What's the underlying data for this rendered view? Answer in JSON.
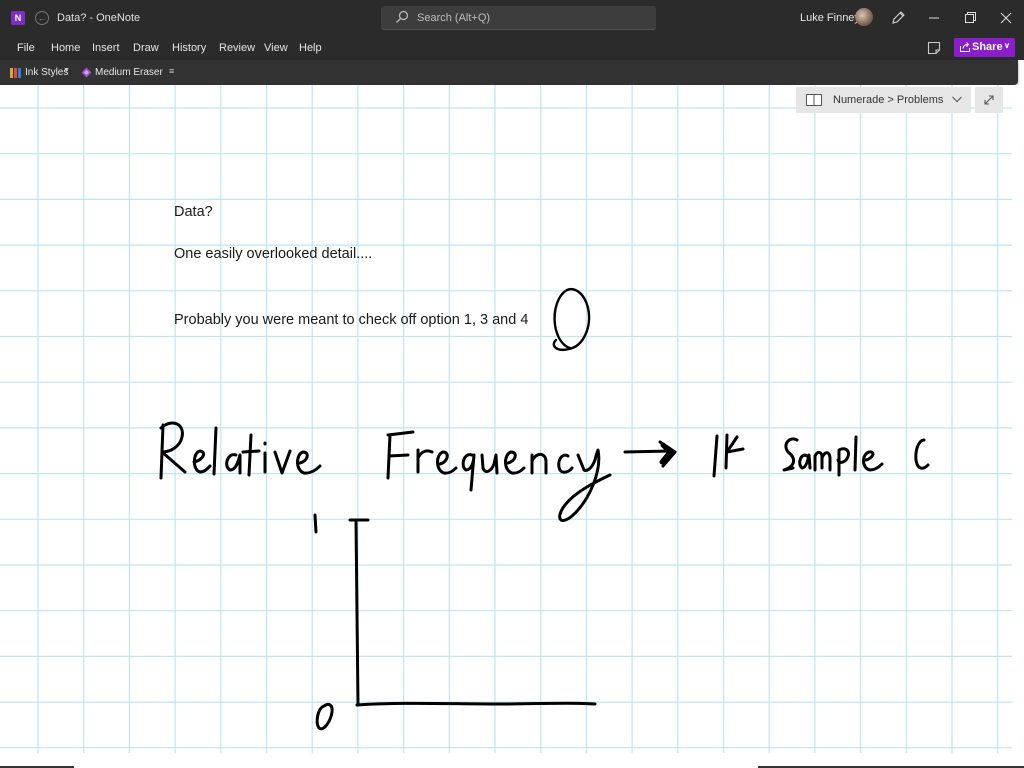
{
  "titlebar": {
    "app_icon_letter": "N",
    "window_title": "Data?  -  OneNote",
    "search_placeholder": "Search (Alt+Q)",
    "user_name": "Luke Finney"
  },
  "menu": {
    "items": [
      "File",
      "Home",
      "Insert",
      "Draw",
      "History",
      "Review",
      "View",
      "Help"
    ],
    "share_label": "Share"
  },
  "toolbar": {
    "ink_styles_label": "Ink Styles",
    "eraser_label": "Medium Eraser"
  },
  "breadcrumb": {
    "label": "Numerade > Problems"
  },
  "colors": {
    "chrome_bg": "#2b2b2b",
    "share_accent": "#8a1fc9",
    "grid_line": "#bfe6ee",
    "ink": "#000000"
  },
  "page": {
    "title": "Data?",
    "line1": "One easily overlooked detail....",
    "line2": "Probably you were meant to check off option 1, 3 and 4"
  },
  "ink_notes": {
    "heading": "Relative Frequency → If Sample e",
    "axis_top_label": "1",
    "axis_bottom_label": "0"
  }
}
